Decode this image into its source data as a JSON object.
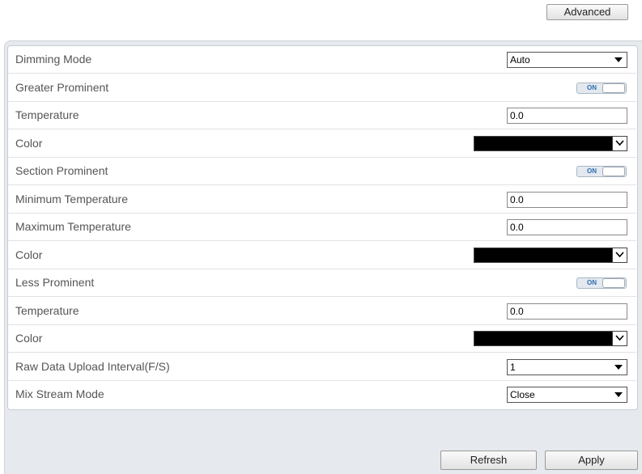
{
  "header": {
    "advanced_label": "Advanced"
  },
  "rows": [
    {
      "label": "Dimming Mode",
      "type": "select",
      "value": "Auto"
    },
    {
      "label": "Greater Prominent",
      "type": "toggle",
      "value": "ON"
    },
    {
      "label": "Temperature",
      "type": "input",
      "value": "0.0"
    },
    {
      "label": "Color",
      "type": "color",
      "value": "#000000"
    },
    {
      "label": "Section Prominent",
      "type": "toggle",
      "value": "ON"
    },
    {
      "label": "Minimum Temperature",
      "type": "input",
      "value": "0.0"
    },
    {
      "label": "Maximum Temperature",
      "type": "input",
      "value": "0.0"
    },
    {
      "label": "Color",
      "type": "color",
      "value": "#000000"
    },
    {
      "label": "Less Prominent",
      "type": "toggle",
      "value": "ON"
    },
    {
      "label": "Temperature",
      "type": "input",
      "value": "0.0"
    },
    {
      "label": "Color",
      "type": "color",
      "value": "#000000"
    },
    {
      "label": "Raw Data Upload Interval(F/S)",
      "type": "select",
      "value": "1"
    },
    {
      "label": "Mix Stream Mode",
      "type": "select",
      "value": "Close"
    }
  ],
  "footer": {
    "refresh_label": "Refresh",
    "apply_label": "Apply"
  }
}
